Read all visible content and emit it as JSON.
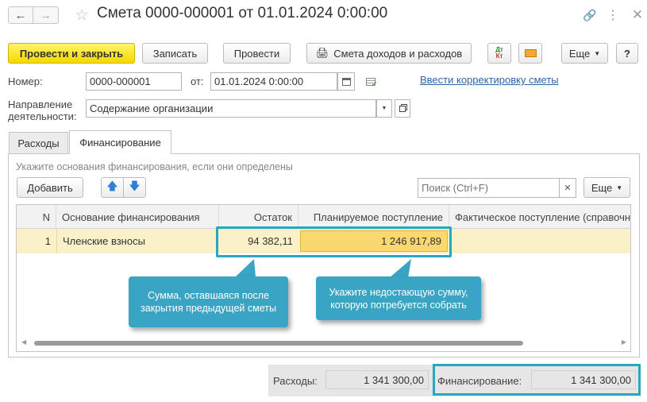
{
  "window": {
    "title": "Смета 0000-000001 от 01.01.2024 0:00:00"
  },
  "toolbar": {
    "post_and_close": "Провести и закрыть",
    "save": "Записать",
    "post": "Провести",
    "report": "Смета доходов и расходов",
    "dt_top": "Дт",
    "dt_bottom": "Кт",
    "more": "Еще",
    "help": "?"
  },
  "form": {
    "number_label": "Номер:",
    "number_value": "0000-000001",
    "date_label": "от:",
    "date_value": "01.01.2024  0:00:00",
    "correction_link": "Ввести корректировку сметы",
    "direction_label_1": "Направление",
    "direction_label_2": "деятельности:",
    "direction_value": "Содержание организации"
  },
  "tabs": [
    {
      "label": "Расходы"
    },
    {
      "label": "Финансирование"
    }
  ],
  "financing": {
    "hint": "Укажите основания финансирования, если они определены",
    "add_button": "Добавить",
    "search_placeholder": "Поиск (Ctrl+F)",
    "more": "Еще",
    "columns": [
      "N",
      "Основание финансирования",
      "Остаток",
      "Планируемое поступление",
      "Фактическое поступление (справочно)"
    ],
    "rows": [
      {
        "n": "1",
        "basis": "Членские взносы",
        "balance": "94 382,11",
        "planned": "1 246 917,89",
        "actual": ""
      }
    ]
  },
  "callouts": {
    "left": "Сумма, оставшаяся после закрытия предыдущей сметы",
    "right": "Укажите недостающую сумму, которую потребуется собрать"
  },
  "totals": {
    "expenses_label": "Расходы:",
    "expenses_value": "1 341 300,00",
    "financing_label": "Финансирование:",
    "financing_value": "1 341 300,00"
  },
  "colors": {
    "highlight": "#2aa6c0",
    "selected_row": "#fbf1c8",
    "primary_button": "#f5d800",
    "link": "#3164a8"
  }
}
